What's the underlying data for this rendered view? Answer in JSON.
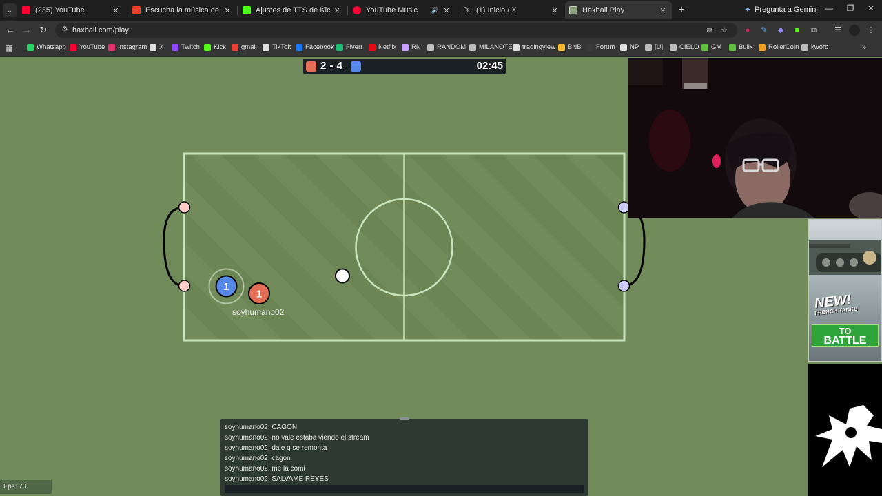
{
  "tabs": [
    {
      "label": "(235) YouTube",
      "icon": "youtube-icon",
      "color": "#ff0033",
      "active": false
    },
    {
      "label": "Escucha la música de STRI NW",
      "icon": "bandcamp-icon",
      "color": "#e8412c",
      "active": false
    },
    {
      "label": "Ajustes de TTS de KickBot",
      "icon": "kickbot-icon",
      "color": "#53fc18",
      "active": false
    },
    {
      "label": "YouTube Music",
      "icon": "youtube-music-icon",
      "color": "#ff0033",
      "active": false
    },
    {
      "label": "(1) Inicio / X",
      "icon": "x-icon",
      "color": "#e0e0e0",
      "active": false
    },
    {
      "label": "Haxball Play",
      "icon": "haxball-icon",
      "color": "#8aa07a",
      "active": true
    }
  ],
  "gemini_label": "Pregunta a Gemini",
  "url": "haxball.com/play",
  "bookmarks": [
    {
      "label": "Whatsapp",
      "color": "#25d366"
    },
    {
      "label": "YouTube",
      "color": "#ff0033"
    },
    {
      "label": "Instagram",
      "color": "#e1306c"
    },
    {
      "label": "X",
      "color": "#e0e0e0"
    },
    {
      "label": "Twitch",
      "color": "#9146ff"
    },
    {
      "label": "Kick",
      "color": "#53fc18"
    },
    {
      "label": "gmail",
      "color": "#ea4335"
    },
    {
      "label": "TikTok",
      "color": "#e0e0e0"
    },
    {
      "label": "Facebook",
      "color": "#1877f2"
    },
    {
      "label": "Fiverr",
      "color": "#1dbf73"
    },
    {
      "label": "Netflix",
      "color": "#e50914"
    },
    {
      "label": "RN",
      "color": "#c7a0ff"
    },
    {
      "label": "RANDOM",
      "color": "#bdbdbd"
    },
    {
      "label": "MILANOTE",
      "color": "#bdbdbd"
    },
    {
      "label": "tradingview",
      "color": "#e0e0e0"
    },
    {
      "label": "BNB",
      "color": "#f3ba2f"
    },
    {
      "label": "Forum",
      "color": "#3a3a3a"
    },
    {
      "label": "NP",
      "color": "#e0e0e0"
    },
    {
      "label": "[U]",
      "color": "#bdbdbd"
    },
    {
      "label": "CIELO",
      "color": "#bdbdbd"
    },
    {
      "label": "GM",
      "color": "#5fbf3f"
    },
    {
      "label": "Bullx",
      "color": "#5fbf3f"
    },
    {
      "label": "RollerCoin",
      "color": "#f0a020"
    },
    {
      "label": "kworb",
      "color": "#bdbdbd"
    }
  ],
  "scoreboard": {
    "score": "2 - 4",
    "time": "02:45",
    "red_color": "#e56e56",
    "blue_color": "#5689e5"
  },
  "players": [
    {
      "team": "blue",
      "number": "1"
    },
    {
      "team": "red",
      "number": "1"
    }
  ],
  "player_name": "soyhumano02",
  "chat": [
    "soyhumano02: CAGON",
    "soyhumano02: no vale estaba viendo el stream",
    "soyhumano02: dale q se remonta",
    "soyhumano02: cagon",
    "soyhumano02: me la comi",
    "soyhumano02: SALVAME REYES"
  ],
  "fps": "Fps: 73",
  "ad": {
    "headline": "NEW!",
    "sub": "FRENCH TANKS",
    "cta_line1": "TO",
    "cta_line2": "BATTLE"
  }
}
